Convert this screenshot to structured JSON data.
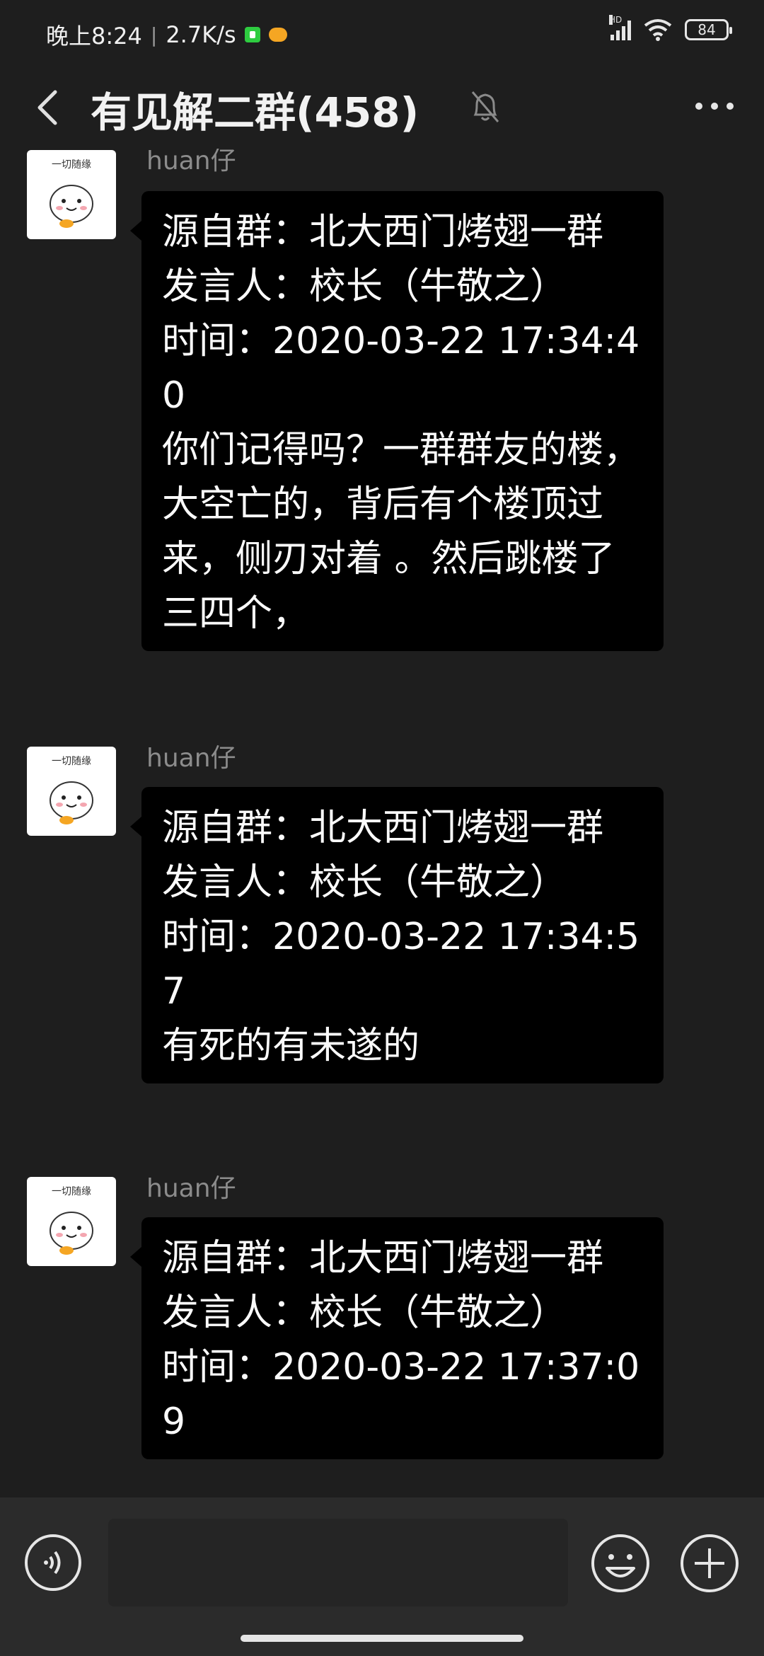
{
  "status_bar": {
    "time": "晚上8:24",
    "speed": "2.7K/s",
    "network": "HD",
    "battery": "84"
  },
  "header": {
    "title": "有见解二群(458)"
  },
  "messages": [
    {
      "avatar_caption": "一切随缘",
      "sender": "huan仔",
      "text": "源自群：北大西门烤翅一群\n发言人：校长（牛敬之）\n时间：2020-03-22 17:34:40\n你们记得吗？一群群友的楼，大空亡的，背后有个楼顶过来，侧刃对着 。然后跳楼了三四个，"
    },
    {
      "avatar_caption": "一切随缘",
      "sender": "huan仔",
      "text": "源自群：北大西门烤翅一群\n发言人：校长（牛敬之）\n时间：2020-03-22 17:34:57\n有死的有未遂的"
    },
    {
      "avatar_caption": "一切随缘",
      "sender": "huan仔",
      "text": "源自群：北大西门烤翅一群\n发言人：校长（牛敬之）\n时间：2020-03-22 17:37:09"
    }
  ],
  "input": {
    "value": ""
  },
  "colors": {
    "background": "#1e1e1e",
    "bubble": "#000000",
    "input_bar": "#2b2b2b",
    "sender": "#8c8c8c"
  },
  "icons": [
    "back-icon",
    "mute-bell-icon",
    "more-icon",
    "voice-icon",
    "emoji-icon",
    "plus-icon"
  ]
}
